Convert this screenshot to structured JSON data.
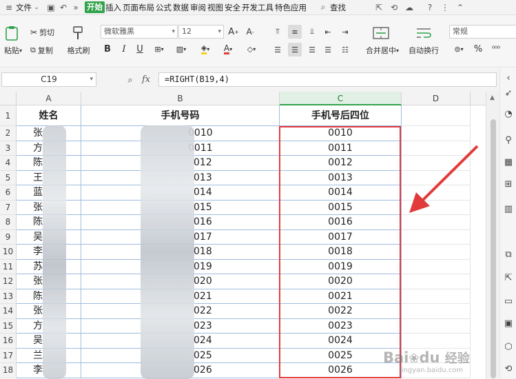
{
  "menubar": {
    "file": "文件",
    "items": [
      "插入",
      "页面布局",
      "公式",
      "数据",
      "审阅",
      "视图",
      "安全",
      "开发工具",
      "特色应用"
    ],
    "active_tab": "开始",
    "search": "查找"
  },
  "ribbon": {
    "paste": "粘贴",
    "cut": "剪切",
    "copy": "复制",
    "format_painter": "格式刷",
    "font_name": "微软雅黑",
    "font_size": "12",
    "merge_center": "合并居中",
    "wrap_text": "自动换行",
    "number_format": "常规"
  },
  "formula_bar": {
    "name_box": "C19",
    "fx_label": "fx",
    "formula": "=RIGHT(B19,4)"
  },
  "columns": [
    "A",
    "B",
    "C",
    "D"
  ],
  "header_row": {
    "row": "1",
    "a": "姓名",
    "b": "手机号码",
    "c": "手机号后四位"
  },
  "rows": [
    {
      "row": "2",
      "a": "张",
      "b": "0010",
      "c": "0010"
    },
    {
      "row": "3",
      "a": "方",
      "b": "0011",
      "c": "0011"
    },
    {
      "row": "4",
      "a": "陈",
      "b": "012",
      "c": "0012"
    },
    {
      "row": "5",
      "a": "王",
      "b": "013",
      "c": "0013"
    },
    {
      "row": "6",
      "a": "蓝",
      "b": "014",
      "c": "0014"
    },
    {
      "row": "7",
      "a": "张",
      "b": "015",
      "c": "0015"
    },
    {
      "row": "8",
      "a": "陈",
      "b": "016",
      "c": "0016"
    },
    {
      "row": "9",
      "a": "吴",
      "b": "017",
      "c": "0017"
    },
    {
      "row": "10",
      "a": "李",
      "b": "018",
      "c": "0018"
    },
    {
      "row": "11",
      "a": "苏",
      "b": "019",
      "c": "0019"
    },
    {
      "row": "12",
      "a": "张",
      "b": "020",
      "c": "0020"
    },
    {
      "row": "13",
      "a": "陈",
      "b": "021",
      "c": "0021"
    },
    {
      "row": "14",
      "a": "张",
      "b": "022",
      "c": "0022"
    },
    {
      "row": "15",
      "a": "方",
      "b": "023",
      "c": "0023"
    },
    {
      "row": "16",
      "a": "吴",
      "b": "024",
      "c": "0024"
    },
    {
      "row": "17",
      "a": "兰",
      "b": "025",
      "c": "0025"
    },
    {
      "row": "18",
      "a": "李",
      "b": "026",
      "c": "0026"
    }
  ],
  "watermark": {
    "brand": "Bai",
    "paw": "du",
    "text": "经验",
    "url": "jingyan.baidu.com"
  },
  "colors": {
    "accent_green": "#2fa24a",
    "highlight_red": "#e23a3a"
  }
}
